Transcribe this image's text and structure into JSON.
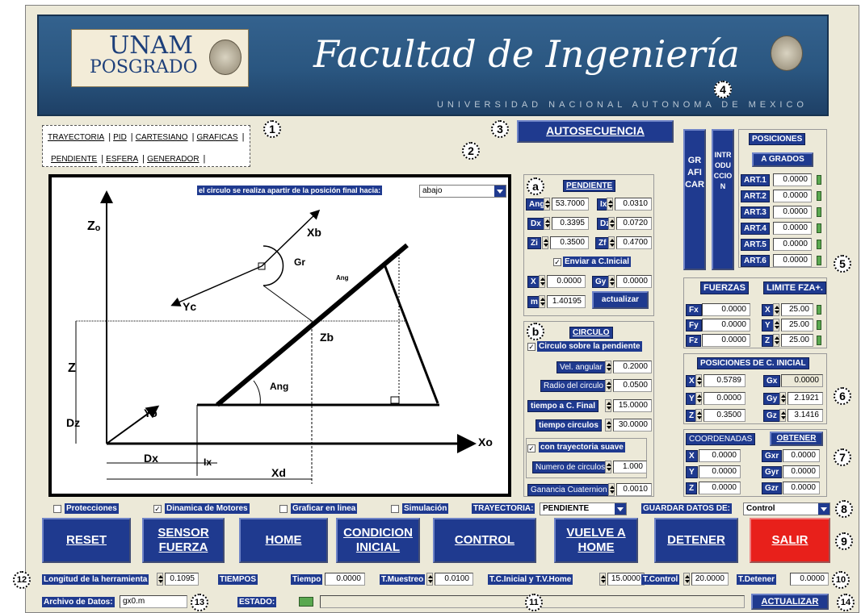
{
  "banner": {
    "title": "Facultad de Ingeniería",
    "subtitle": "UNIVERSIDAD NACIONAL AUTONOMA DE MEXICO",
    "logo_top": "UNAM",
    "logo_bottom": "POSGRADO"
  },
  "tabs": [
    "TRAYECTORIA",
    "PID",
    "CARTESIANO",
    "GRAFICAS",
    "PENDIENTE",
    "ESFERA",
    "GENERADOR"
  ],
  "autosecuencia": "AUTOSECUENCIA",
  "graficar": "GRAFICAR",
  "introduccion": "INTRODUCCION",
  "diagram": {
    "dropdown_label": "el circulo se realiza apartir de la posición final hacia:",
    "dropdown_value": "abajo",
    "lbl_Zo": "Zₒ",
    "lbl_Xb": "Xb",
    "lbl_Gr": "Gr",
    "lbl_Ang1": "Ang",
    "lbl_Yc": "Yc",
    "lbl_Zb": "Zb",
    "lbl_Z": "Z",
    "lbl_Ang2": "Ang",
    "lbl_Yo": "Yo",
    "lbl_Dz": "Dz",
    "lbl_Xo": "Xo",
    "lbl_Dx": "Dx",
    "lbl_Ix": "Ix",
    "lbl_Xd": "Xd"
  },
  "pendiente": {
    "title": "PENDIENTE",
    "ang_l": "Ang",
    "ang": "53.7000",
    "ix_l": "Ix",
    "ix": "0.0310",
    "dx_l": "Dx",
    "dx": "0.3395",
    "dz_l": "Dz",
    "dz": "0.0720",
    "zi_l": "Zi",
    "zi": "0.3500",
    "zf_l": "Zf",
    "zf": "0.4700",
    "enviar": "Enviar a C.Inicial",
    "x_l": "X",
    "x": "0.0000",
    "gy_l": "Gy",
    "gy": "0.0000",
    "m_l": "m",
    "m": "1.40195",
    "actualizar": "actualizar"
  },
  "circulo": {
    "title": "CIRCULO",
    "sobre": "Circulo sobre la pendiente",
    "vel_l": "Vel. angular",
    "vel": "0.2000",
    "radio_l": "Radio del circulo",
    "radio": "0.0500",
    "tcf_l": "tiempo a C. Final",
    "tcf": "15.0000",
    "tcirc_l": "tiempo circulos",
    "tcirc": "30.0000",
    "suave": "con trayectoria suave",
    "ncirc_l": "Numero de circulos",
    "ncirc": "1.000",
    "gan_l": "Ganancia Cuaternion",
    "gan": "0.0010"
  },
  "posiciones": {
    "title": "POSICIONES",
    "grados": "A GRADOS",
    "arts": [
      {
        "l": "ART.1",
        "v": "0.0000"
      },
      {
        "l": "ART.2",
        "v": "0.0000"
      },
      {
        "l": "ART.3",
        "v": "0.0000"
      },
      {
        "l": "ART.4",
        "v": "0.0000"
      },
      {
        "l": "ART.5",
        "v": "0.0000"
      },
      {
        "l": "ART.6",
        "v": "0.0000"
      }
    ]
  },
  "fuerzas": {
    "title": "FUERZAS",
    "limite": "LIMITE FZA+.",
    "fx_l": "Fx",
    "fx": "0.0000",
    "fy_l": "Fy",
    "fy": "0.0000",
    "fz_l": "Fz",
    "fz": "0.0000",
    "lx_l": "X",
    "lx": "25.00",
    "ly_l": "Y",
    "ly": "25.00",
    "lz_l": "Z",
    "lz": "25.00"
  },
  "cinicial": {
    "title": "POSICIONES DE C. INICIAL",
    "x_l": "X",
    "x": "0.5789",
    "gx_l": "Gx",
    "gx": "0.0000",
    "y_l": "Y",
    "y": "0.0000",
    "gy_l": "Gy",
    "gy": "2.1921",
    "z_l": "Z",
    "z": "0.3500",
    "gz_l": "Gz",
    "gz": "3.1416"
  },
  "coord": {
    "title": "COORDENADAS",
    "obtener": "OBTENER",
    "x_l": "X",
    "x": "0.0000",
    "gxr_l": "Gxr",
    "gxr": "0.0000",
    "y_l": "Y",
    "y": "0.0000",
    "gyr_l": "Gyr",
    "gyr": "0.0000",
    "z_l": "Z",
    "z": "0.0000",
    "gzr_l": "Gzr",
    "gzr": "0.0000"
  },
  "options": {
    "protecciones": "Protecciones",
    "dinamica": "Dinamica de Motores",
    "graficar": "Graficar en linea",
    "simulacion": "Simulación",
    "tray_l": "TRAYECTORIA:",
    "tray": "PENDIENTE",
    "guardar_l": "GUARDAR DATOS DE:",
    "guardar": "Control"
  },
  "buttons": {
    "reset": "RESET",
    "sensor": "SENSOR FUERZA",
    "home": "HOME",
    "condicion": "CONDICION INICIAL",
    "control": "CONTROL",
    "vuelve": "VUELVE A HOME",
    "detener": "DETENER",
    "salir": "SALIR"
  },
  "bottom": {
    "longitud_l": "Longitud de la herramienta",
    "longitud": "0.1095",
    "tiempos": "TIEMPOS",
    "tiempo_l": "Tiempo",
    "tiempo": "0.0000",
    "tmuestreo_l": "T.Muestreo",
    "tmuestreo": "0.0100",
    "tci_l": "T.C.Inicial y T.V.Home",
    "tci": "15.0000",
    "tcontrol_l": "T.Control",
    "tcontrol": "20.0000",
    "tdetener_l": "T.Detener",
    "tdetener": "0.0000",
    "archivo_l": "Archivo de Datos:",
    "archivo": "gx0.m",
    "estado_l": "ESTADO:",
    "actualizar": "ACTUALIZAR"
  },
  "markers": [
    "1",
    "2",
    "3",
    "4",
    "5",
    "6",
    "7",
    "8",
    "9",
    "10",
    "11",
    "12",
    "13",
    "14",
    "a",
    "b"
  ]
}
